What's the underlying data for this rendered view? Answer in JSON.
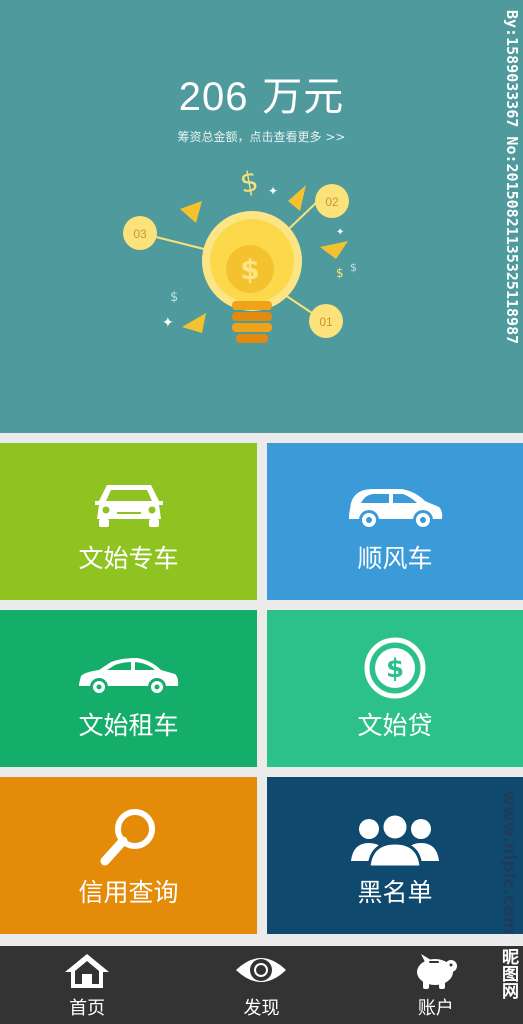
{
  "hero": {
    "amount": "206",
    "unit": "万元",
    "subtitle": "筹资总金额，点击查看更多 >>",
    "badges": [
      "03",
      "02",
      "01"
    ]
  },
  "tiles": [
    {
      "label": "文始专车",
      "color": "#8ec322",
      "icon": "car-front-icon"
    },
    {
      "label": "顺风车",
      "color": "#3b9ad8",
      "icon": "hatchback-icon"
    },
    {
      "label": "文始租车",
      "color": "#15ad6a",
      "icon": "sedan-icon"
    },
    {
      "label": "文始贷",
      "color": "#2cc18b",
      "icon": "dollar-coin-icon"
    },
    {
      "label": "信用查询",
      "color": "#e48b0a",
      "icon": "magnifier-icon"
    },
    {
      "label": "黑名单",
      "color": "#0f4a6e",
      "icon": "group-people-icon"
    }
  ],
  "nav": [
    {
      "label": "首页",
      "icon": "home-icon"
    },
    {
      "label": "发现",
      "icon": "eye-icon"
    },
    {
      "label": "账户",
      "icon": "piggy-bank-icon"
    }
  ],
  "watermark": {
    "id_text": "By:1589033367 No:20150821135325118987",
    "site": "www.nipic.com",
    "brand": "昵图网"
  }
}
